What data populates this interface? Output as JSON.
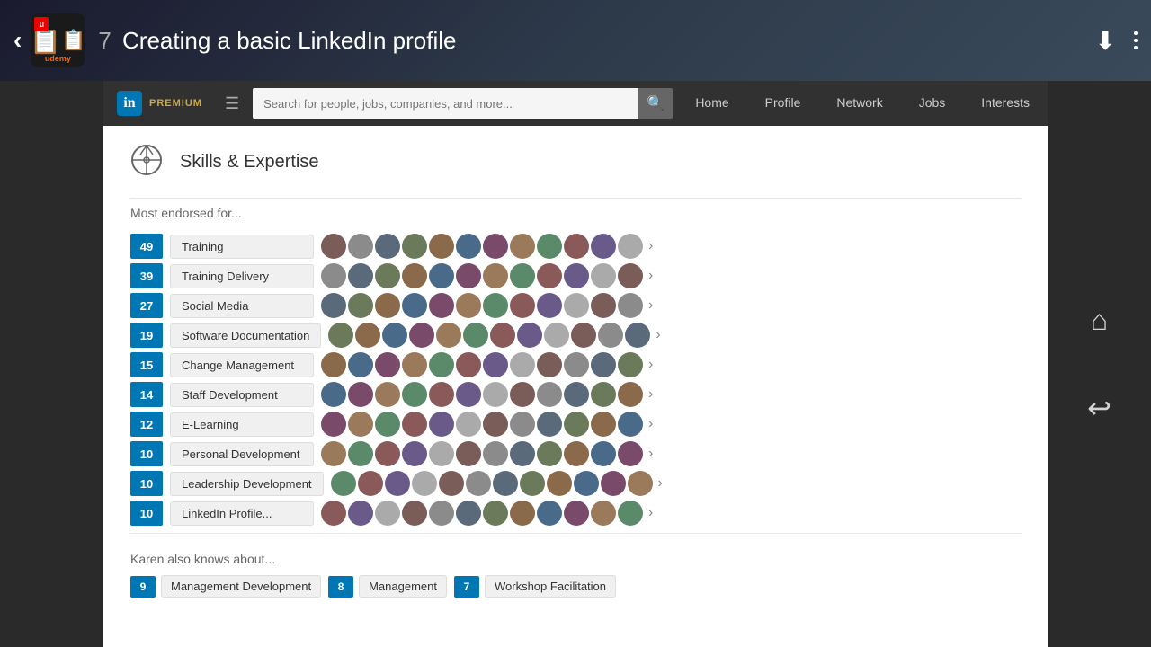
{
  "topbar": {
    "back_label": "‹",
    "course_number": "7",
    "course_title": "Creating a basic LinkedIn profile",
    "udemy_label": "udemy"
  },
  "nav": {
    "logo_text": "in",
    "premium_label": "PREMIUM",
    "search_placeholder": "Search for people, jobs, companies, and more...",
    "items": [
      {
        "label": "Home",
        "id": "home"
      },
      {
        "label": "Profile",
        "id": "profile"
      },
      {
        "label": "Network",
        "id": "network"
      },
      {
        "label": "Jobs",
        "id": "jobs"
      },
      {
        "label": "Interests",
        "id": "interests"
      }
    ]
  },
  "skills_section": {
    "title": "Skills & Expertise",
    "most_endorsed_label": "Most endorsed for...",
    "skills": [
      {
        "count": 49,
        "name": "Training"
      },
      {
        "count": 39,
        "name": "Training Delivery"
      },
      {
        "count": 27,
        "name": "Social Media"
      },
      {
        "count": 19,
        "name": "Software Documentation"
      },
      {
        "count": 15,
        "name": "Change Management"
      },
      {
        "count": 14,
        "name": "Staff Development"
      },
      {
        "count": 12,
        "name": "E-Learning"
      },
      {
        "count": 10,
        "name": "Personal Development"
      },
      {
        "count": 10,
        "name": "Leadership Development"
      },
      {
        "count": 10,
        "name": "LinkedIn Profile..."
      }
    ],
    "also_knows_label": "Karen also knows about...",
    "also_knows": [
      {
        "count": 9,
        "name": "Management Development"
      },
      {
        "count": 8,
        "name": "Management"
      },
      {
        "count": 7,
        "name": "Workshop Facilitation"
      }
    ]
  },
  "icons": {
    "download": "⬇",
    "more": "⋮",
    "search": "🔍",
    "arrow_right": "›",
    "home_icon": "⌂",
    "back_icon": "↩"
  }
}
